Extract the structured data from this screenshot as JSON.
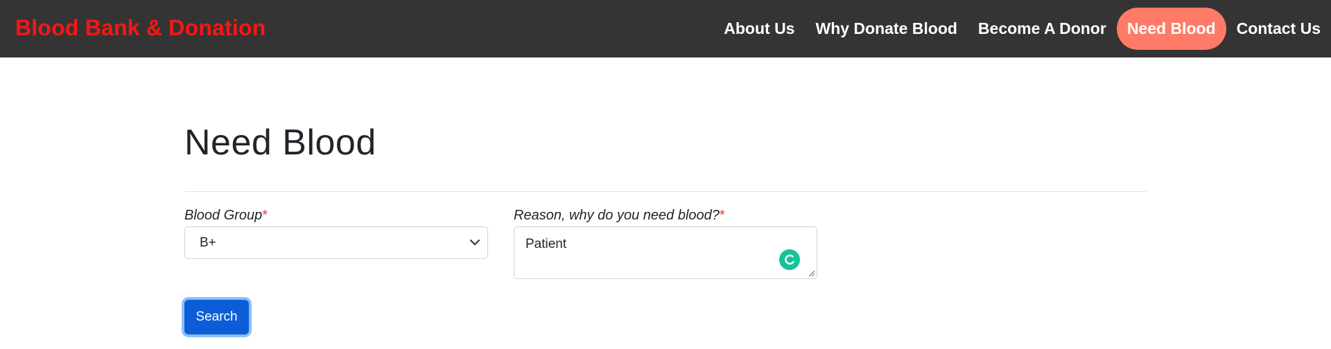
{
  "navbar": {
    "brand": "Blood Bank & Donation",
    "links": [
      {
        "label": "About Us",
        "active": false
      },
      {
        "label": "Why Donate Blood",
        "active": false
      },
      {
        "label": "Become A Donor",
        "active": false
      },
      {
        "label": "Need Blood",
        "active": true
      },
      {
        "label": "Contact Us",
        "active": false
      }
    ]
  },
  "main": {
    "title": "Need Blood",
    "form": {
      "blood_group": {
        "label": "Blood Group",
        "required_mark": "*",
        "selected_value": "B+"
      },
      "reason": {
        "label": "Reason, why do you need blood?",
        "required_mark": "*",
        "value": "Patient"
      },
      "submit_label": "Search"
    }
  },
  "colors": {
    "navbar_bg": "#343434",
    "brand": "#ff1414",
    "active_link_bg": "#ff7b68",
    "button_bg": "#0b5ed7",
    "required": "#e53935",
    "grammar_badge": "#15c39a"
  },
  "icons": {
    "select": "chevron-down-icon",
    "textarea_badge": "grammar-check-icon",
    "textarea_resize": "resize-handle-icon"
  }
}
